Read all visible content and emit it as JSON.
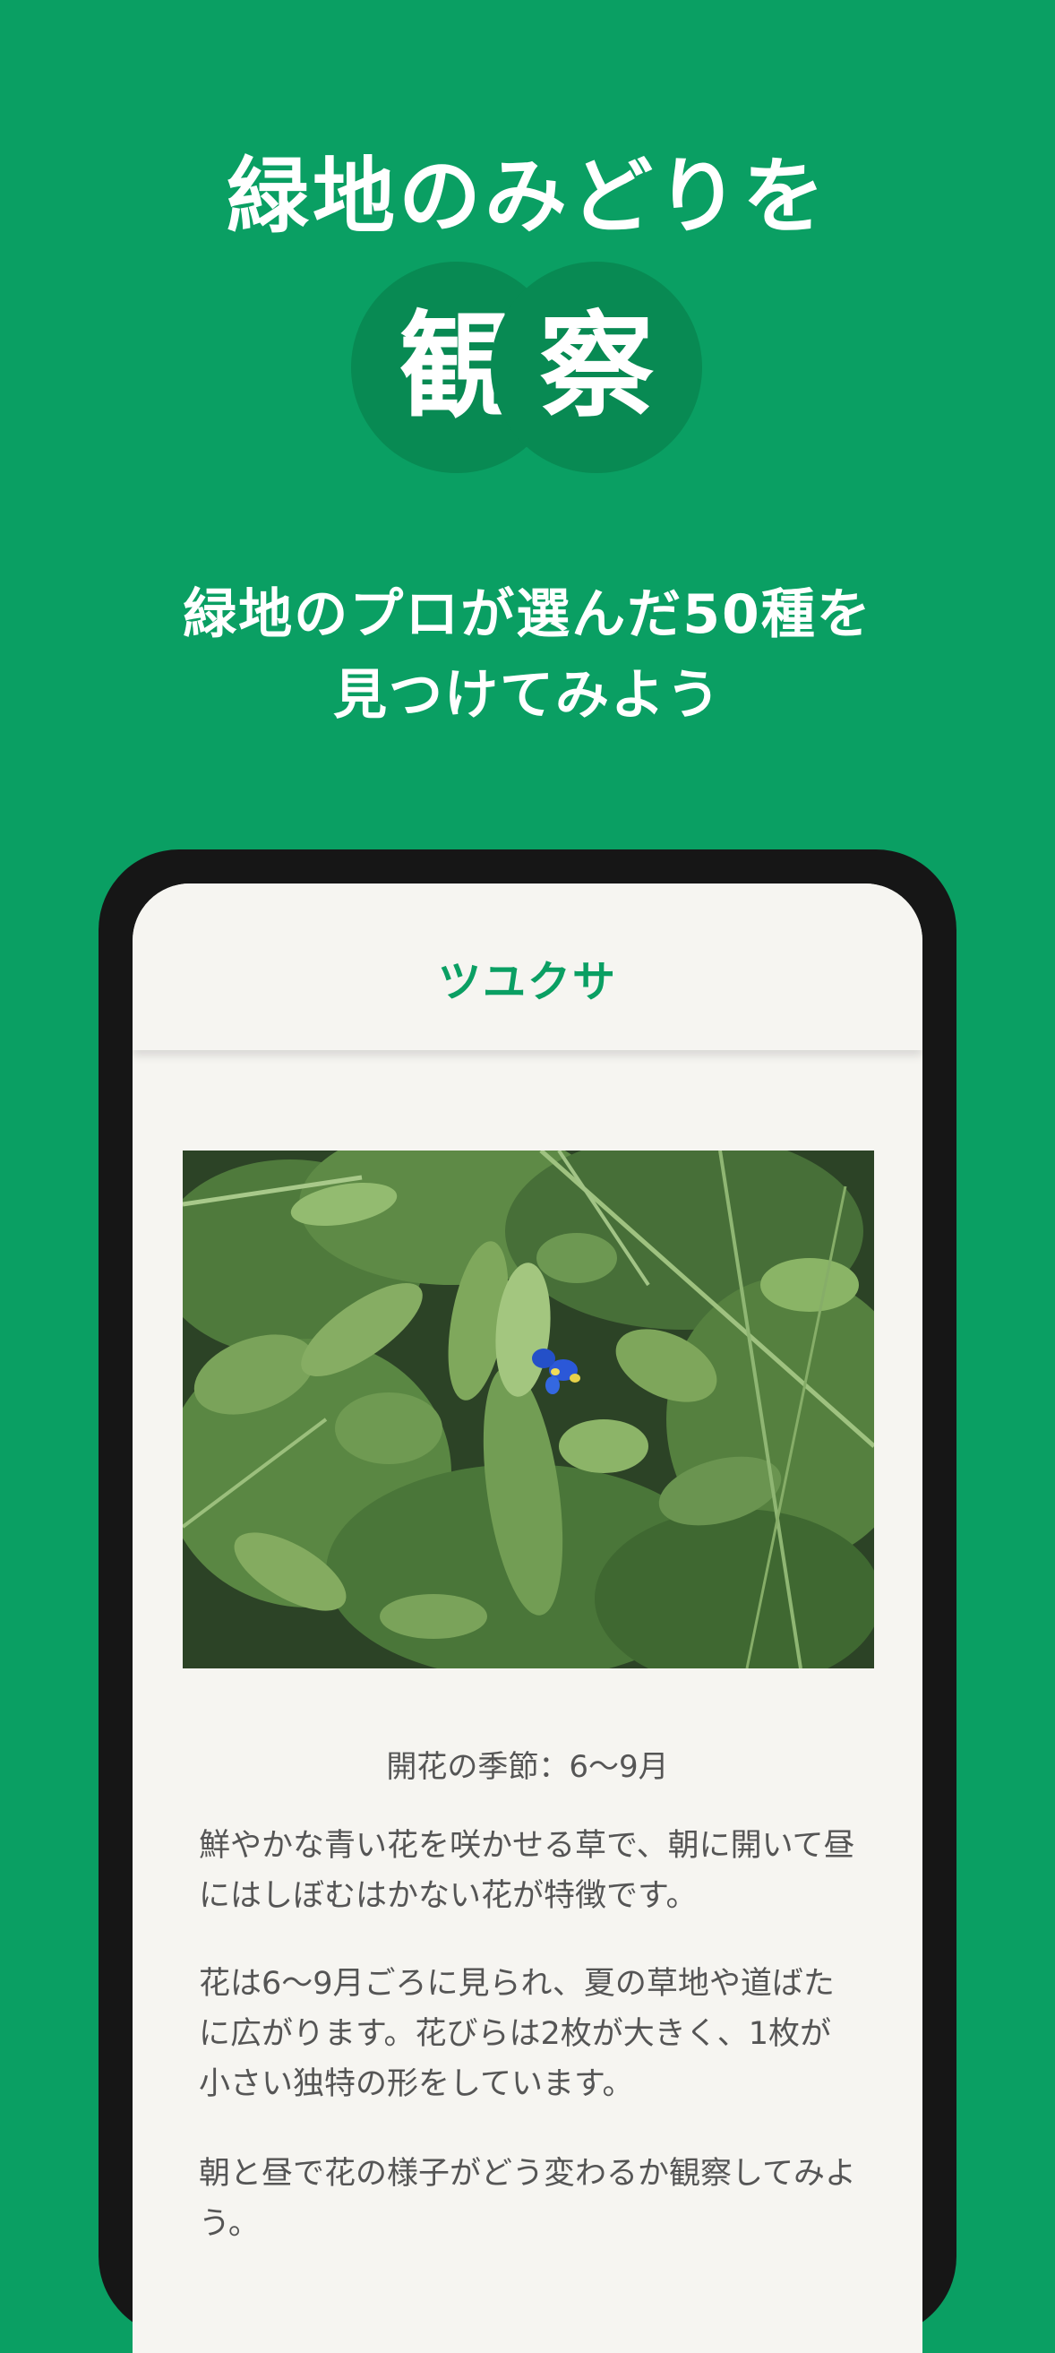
{
  "hero": {
    "line1": "緑地のみどりを",
    "char1": "観",
    "char2": "察",
    "sub_line1": "緑地のプロが選んだ50種を",
    "sub_line2": "見つけてみよう"
  },
  "app": {
    "title": "ツユクサ",
    "photo_alt": "ツユクサ",
    "season": "開花の季節：6〜9月",
    "paragraphs": [
      "鮮やかな青い花を咲かせる草で、朝に開いて昼にはしぼむはかない花が特徴です。",
      "花は6〜9月ごろに見られ、夏の草地や道ばたに広がります。花びらは2枚が大きく、1枚が小さい独特の形をしています。",
      "朝と昼で花の様子がどう変わるか観察してみよう。"
    ]
  },
  "colors": {
    "background": "#0a9f63",
    "circle": "#088a53",
    "accent": "#0a9f63",
    "phone_frame": "#161616",
    "screen": "#f6f5f1",
    "body_text": "#555555"
  }
}
